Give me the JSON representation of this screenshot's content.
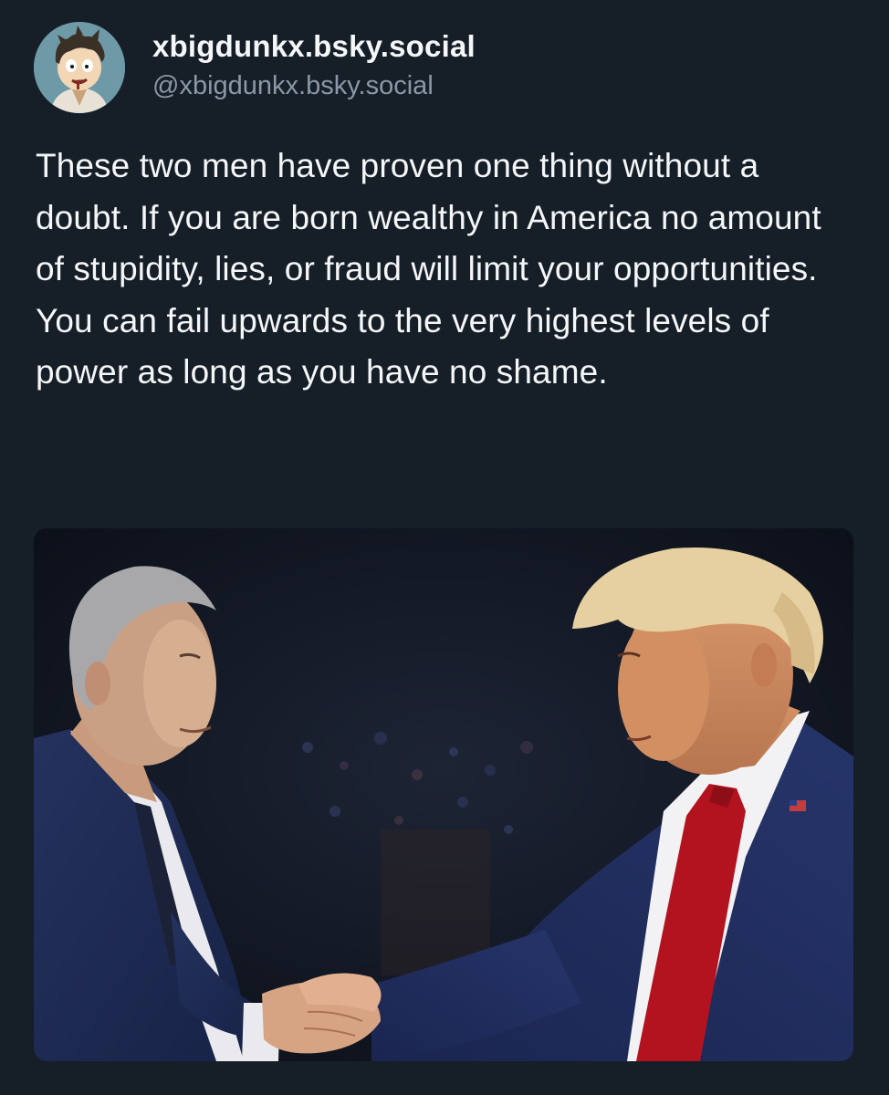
{
  "post": {
    "author": {
      "display_name": "xbigdunkx.bsky.social",
      "handle": "@xbigdunkx.bsky.social",
      "avatar_icon": "cartoon-character-avatar"
    },
    "text": "These two men have proven one thing without a doubt. If you are born wealthy in America no amount of stupidity, lies, or fraud will limit your opportunities. You can fail upwards to the very highest levels of power as long as you have no shame.",
    "media": {
      "type": "photo"
    }
  },
  "colors": {
    "background": "#161e27",
    "text_primary": "#f4f6f8",
    "text_secondary": "#8b98a7"
  }
}
